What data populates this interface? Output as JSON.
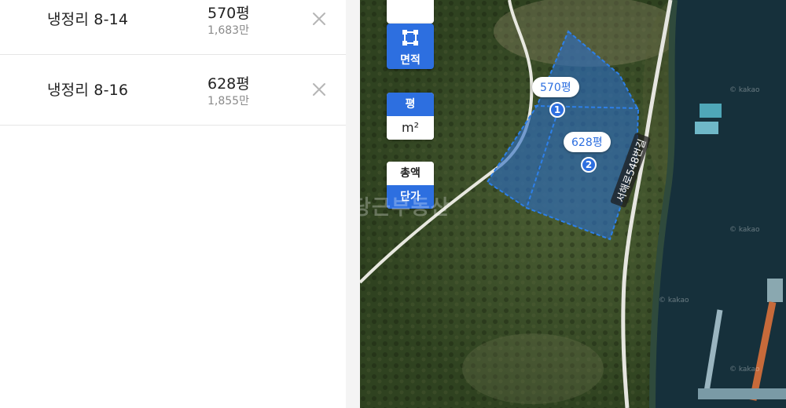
{
  "parcels": [
    {
      "name": "냉정리 8-14",
      "area": "570평",
      "price": "1,683만"
    },
    {
      "name": "냉정리 8-16",
      "area": "628평",
      "price": "1,855만"
    }
  ],
  "icons": {
    "remove": "close-icon",
    "area_tool": "polygon-select-icon"
  },
  "map": {
    "area_button_label": "면적",
    "unit_toggle": {
      "selected": "평",
      "other": "m²"
    },
    "price_toggle": {
      "option_total": "총액",
      "option_unit": "단가",
      "selected": "단가"
    },
    "parcel_labels": [
      {
        "area": "570평",
        "number": "1"
      },
      {
        "area": "628평",
        "number": "2"
      }
    ],
    "watermark": "당근부동산",
    "road_label": "서해로548번길",
    "tile_credit": "© kakao"
  },
  "colors": {
    "accent": "#2d6fe0",
    "parcel_fill": "#2b6cc4",
    "panel_bg": "#ffffff",
    "divider": "#e6e6e6"
  }
}
